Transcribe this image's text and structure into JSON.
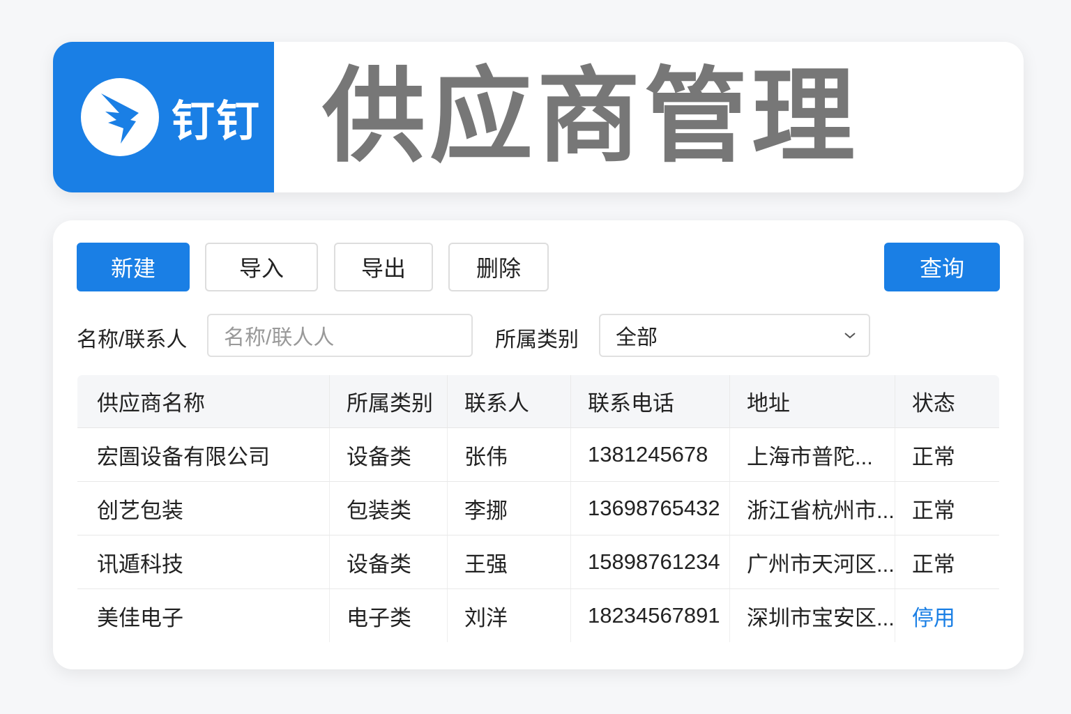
{
  "header": {
    "brand": "钉钉",
    "title": "供应商管理"
  },
  "toolbar": {
    "new": "新建",
    "import": "导入",
    "export": "导出",
    "delete": "删除",
    "query": "查询"
  },
  "filters": {
    "name_label": "名称/联系人",
    "name_placeholder": "名称/联人人",
    "category_label": "所属类别",
    "category_value": "全部"
  },
  "table": {
    "columns": [
      "供应商名称",
      "所属类别",
      "联系人",
      "联系电话",
      "地址",
      "状态"
    ],
    "rows": [
      [
        "宏圄设备有限公司",
        "设备类",
        "张伟",
        "1381245678",
        "上海市普陀...",
        "正常"
      ],
      [
        "创艺包装",
        "包装类",
        "李挪",
        "13698765432",
        "浙江省杭州市...",
        "正常"
      ],
      [
        "讯遁科技",
        "设备类",
        "王强",
        "15898761234",
        "广州市天河区...",
        "正常"
      ],
      [
        "美佳电子",
        "电子类",
        "刘洋",
        "18234567891",
        "深圳市宝安区...",
        "停用"
      ]
    ]
  },
  "colors": {
    "accent": "#1a7fe5",
    "title": "#777777"
  }
}
